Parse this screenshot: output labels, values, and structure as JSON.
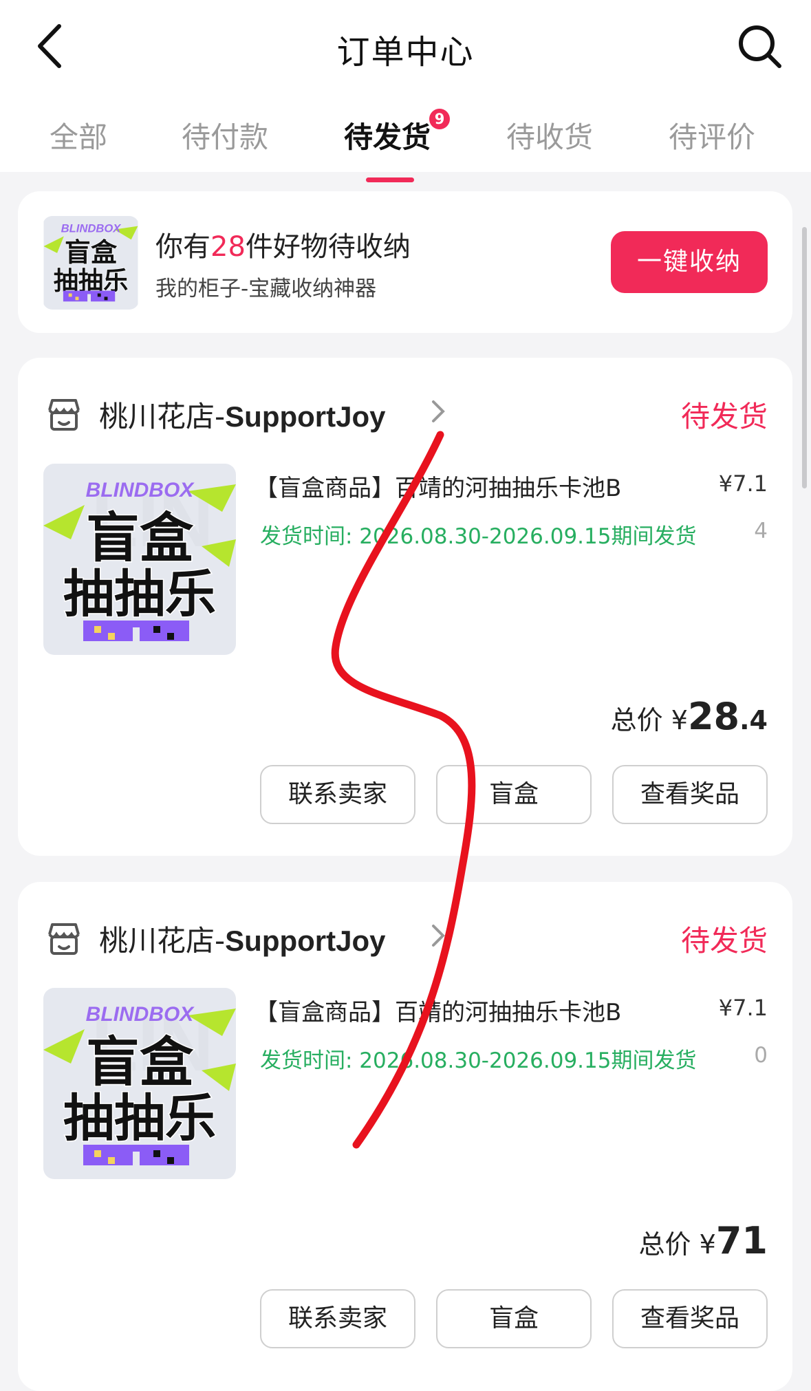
{
  "header": {
    "title": "订单中心",
    "back_icon": "chevron-left-icon",
    "search_icon": "search-icon"
  },
  "tabs": [
    {
      "label": "全部",
      "active": false
    },
    {
      "label": "待付款",
      "active": false
    },
    {
      "label": "待发货",
      "active": true,
      "badge": "9"
    },
    {
      "label": "待收货",
      "active": false
    },
    {
      "label": "待评价",
      "active": false
    }
  ],
  "promo": {
    "prefix": "你有",
    "count": "28",
    "suffix": "件好物待收纳",
    "subtitle": "我的柜子-宝藏收纳神器",
    "button": "一键收纳",
    "thumb_brand": "BLINDBOX",
    "thumb_line1": "盲盒",
    "thumb_line2": "抽抽乐"
  },
  "orders": [
    {
      "shop_cn": "桃川花店-",
      "shop_en": "SupportJoy",
      "status": "待发货",
      "product_name": "【盲盒商品】百靖的河抽抽乐卡池B",
      "price": "¥7.1",
      "ship_time": "发货时间: 2026.08.30-2026.09.15期间发货",
      "qty_tail": "4",
      "total_label": "总价",
      "total_currency": "¥",
      "total_int": "28",
      "total_dec": ".4",
      "buttons": [
        "联系卖家",
        "盲盒",
        "查看奖品"
      ],
      "thumb_brand": "BLINDBOX",
      "thumb_line1": "盲盒",
      "thumb_line2": "抽抽乐"
    },
    {
      "shop_cn": "桃川花店-",
      "shop_en": "SupportJoy",
      "status": "待发货",
      "product_name": "【盲盒商品】百靖的河抽抽乐卡池B",
      "price": "¥7.1",
      "ship_time": "发货时间: 2026.08.30-2026.09.15期间发货",
      "qty_tail": "0",
      "total_label": "总价",
      "total_currency": "¥",
      "total_int": "71",
      "total_dec": "",
      "buttons": [
        "联系卖家",
        "盲盒",
        "查看奖品"
      ],
      "thumb_brand": "BLINDBOX",
      "thumb_line1": "盲盒",
      "thumb_line2": "抽抽乐"
    }
  ],
  "colors": {
    "accent": "#f12a58",
    "ship_green": "#27ae60",
    "scribble": "#e8121e"
  }
}
